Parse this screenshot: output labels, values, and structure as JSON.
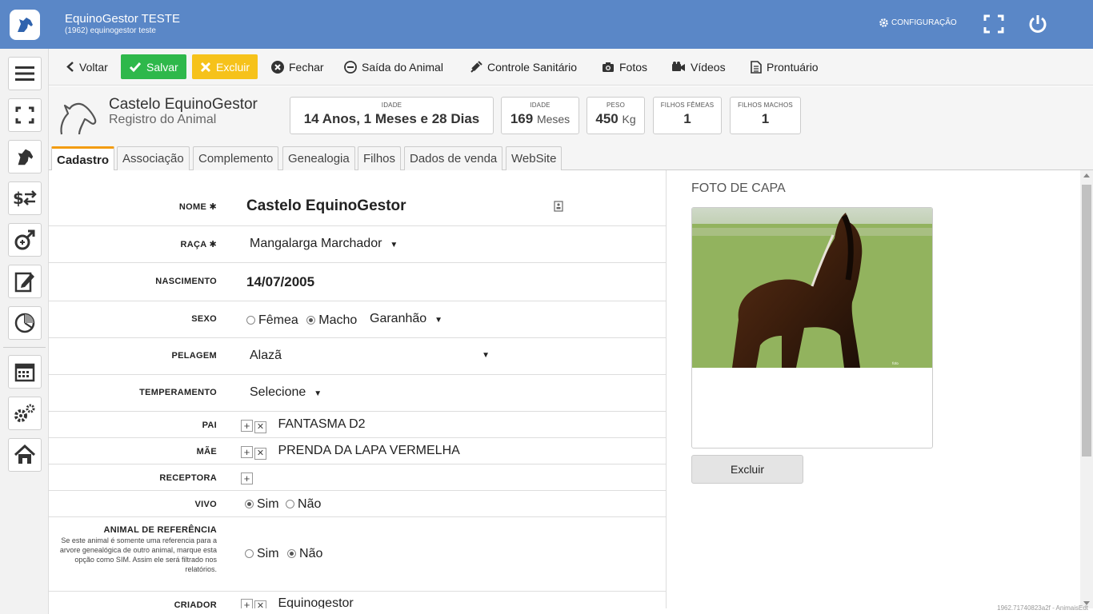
{
  "app": {
    "title": "EquinoGestor TESTE",
    "subtitle": "(1962) equinogestor teste",
    "config_label": "CONFIGURAÇÃO"
  },
  "toolbar": {
    "voltar": "Voltar",
    "salvar": "Salvar",
    "excluir": "Excluir",
    "fechar": "Fechar",
    "saida": "Saída do Animal",
    "sanitario": "Controle Sanitário",
    "fotos": "Fotos",
    "videos": "Vídeos",
    "prontuario": "Prontuário"
  },
  "header": {
    "name": "Castelo EquinoGestor",
    "subtitle": "Registro do Animal",
    "stats": [
      {
        "label": "IDADE",
        "value": "14 Anos, 1 Meses e 28 Dias",
        "unit": ""
      },
      {
        "label": "IDADE",
        "value": "169",
        "unit": "Meses"
      },
      {
        "label": "PESO",
        "value": "450",
        "unit": "Kg"
      },
      {
        "label": "FILHOS FÊMEAS",
        "value": "1",
        "unit": ""
      },
      {
        "label": "FILHOS MACHOS",
        "value": "1",
        "unit": ""
      }
    ]
  },
  "tabs": [
    "Cadastro",
    "Associação",
    "Complemento",
    "Genealogia",
    "Filhos",
    "Dados de venda",
    "WebSite"
  ],
  "form": {
    "nome_label": "NOME",
    "nome": "Castelo EquinoGestor",
    "raca_label": "RAÇA",
    "raca": "Mangalarga Marchador",
    "nascimento_label": "NASCIMENTO",
    "nascimento": "14/07/2005",
    "sexo_label": "SEXO",
    "sexo_femea": "Fêmea",
    "sexo_macho": "Macho",
    "sexo_tipo": "Garanhão",
    "pelagem_label": "PELAGEM",
    "pelagem": "Alazã",
    "temperamento_label": "TEMPERAMENTO",
    "temperamento": "Selecione",
    "pai_label": "PAI",
    "pai": "FANTASMA D2",
    "mae_label": "MÃE",
    "mae": "PRENDA DA LAPA VERMELHA",
    "receptora_label": "RECEPTORA",
    "vivo_label": "VIVO",
    "vivo_sim": "Sim",
    "vivo_nao": "Não",
    "ref_label": "ANIMAL DE REFERÊNCIA",
    "ref_help": "Se este animal é somente uma referencia para a arvore genealógica de outro animal, marque esta opção como SIM. Assim ele será filtrado nos relatórios.",
    "ref_sim": "Sim",
    "ref_nao": "Não",
    "criador_label": "CRIADOR",
    "criador": "Equinogestor"
  },
  "photo": {
    "title": "FOTO DE CAPA",
    "delete": "Excluir"
  },
  "footer": {
    "id": "1962.71740823a2f - AnimaisEdt"
  },
  "colors": {
    "topbar": "#5a87c7",
    "save": "#2eb84b",
    "delete": "#f6c21a",
    "tab_accent": "#f39c12"
  }
}
